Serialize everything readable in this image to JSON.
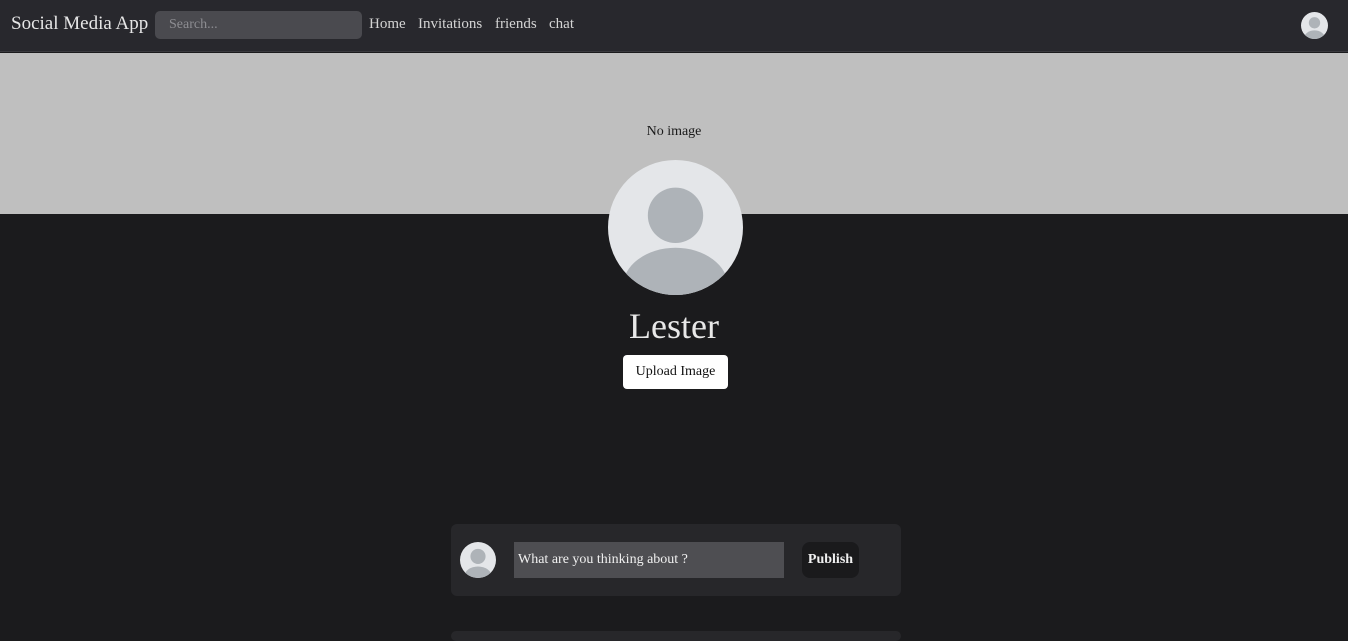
{
  "navbar": {
    "brand": "Social Media App",
    "search_placeholder": "Search...",
    "links": [
      "Home",
      "Invitations",
      "friends",
      "chat"
    ],
    "avatar_icon": "default-user-avatar-icon"
  },
  "profile": {
    "cover_text": "No image",
    "avatar_icon": "default-user-avatar-icon",
    "name": "Lester",
    "upload_label": "Upload Image"
  },
  "composer": {
    "avatar_icon": "default-user-avatar-icon",
    "input_placeholder": "What are you thinking about ?",
    "publish_label": "Publish"
  },
  "colors": {
    "background": "#1b1b1d",
    "navbar": "#28282d",
    "cover": "#bfbfbf",
    "card": "#27272a",
    "avatar_bg": "#e4e6e9",
    "avatar_fg": "#aeb3b8"
  }
}
